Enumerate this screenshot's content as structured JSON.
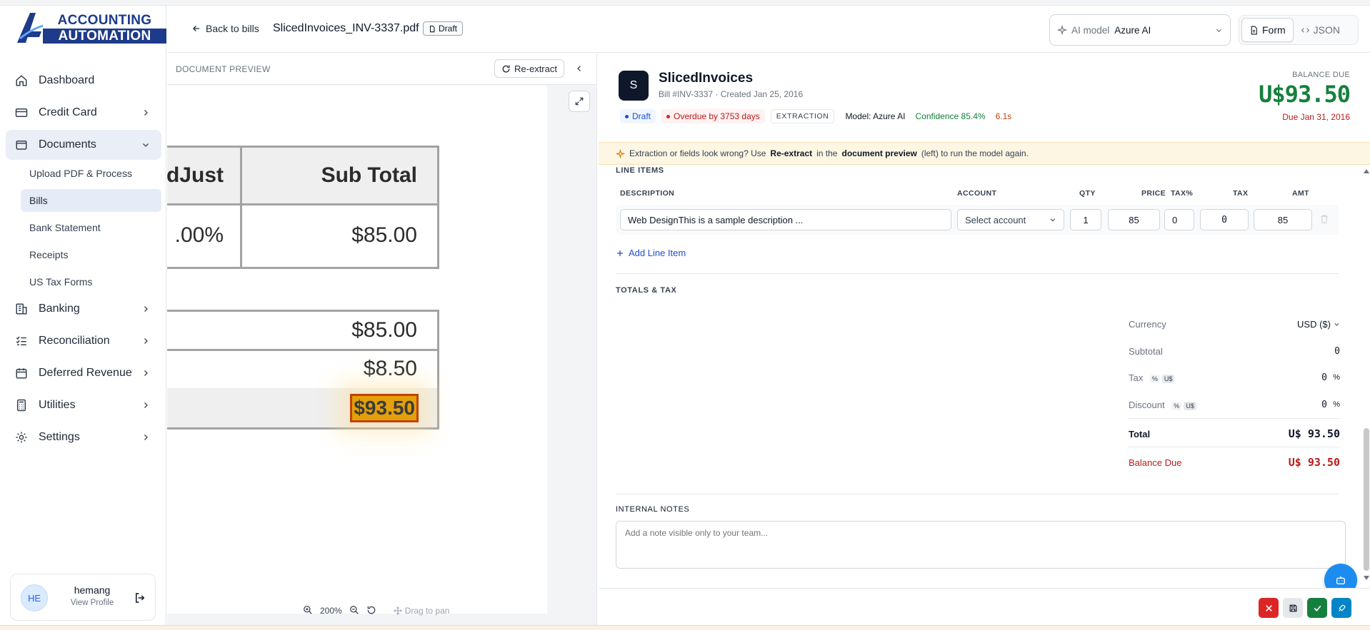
{
  "brand": {
    "line1": "ACCOUNTING",
    "line2": "AUTOMATION"
  },
  "sidebar": {
    "items": [
      {
        "label": "Dashboard",
        "icon": "home-icon"
      },
      {
        "label": "Credit Card",
        "icon": "credit-card-icon"
      },
      {
        "label": "Documents",
        "icon": "document-icon",
        "expanded": true
      },
      {
        "label": "Banking",
        "icon": "bank-icon"
      },
      {
        "label": "Reconciliation",
        "icon": "checklist-icon"
      },
      {
        "label": "Deferred Revenue",
        "icon": "calendar-icon"
      },
      {
        "label": "Utilities",
        "icon": "calculator-icon"
      },
      {
        "label": "Settings",
        "icon": "gear-icon"
      }
    ],
    "documents_sub": [
      {
        "label": "Upload PDF & Process"
      },
      {
        "label": "Bills",
        "active": true
      },
      {
        "label": "Bank Statement"
      },
      {
        "label": "Receipts"
      },
      {
        "label": "US Tax Forms"
      }
    ],
    "profile": {
      "initials": "HE",
      "name": "hemang",
      "link": "View Profile"
    }
  },
  "topbar": {
    "back_label": "Back to bills",
    "file_name": "SlicedInvoices_INV-3337.pdf",
    "status": "Draft",
    "ai_model_label": "AI model",
    "ai_model_value": "Azure AI",
    "view_form": "Form",
    "view_json": "JSON"
  },
  "preview": {
    "title": "DOCUMENT PREVIEW",
    "reextract": "Re-extract",
    "zoom": "200%",
    "drag_hint": "Drag to pan",
    "doc": {
      "adjust_header": "dJust",
      "subtotal_header": "Sub Total",
      "adjust_value": ".00%",
      "row_subtotal": "$85.00",
      "sum_subtotal": "$85.00",
      "sum_tax": "$8.50",
      "sum_total": "$93.50"
    }
  },
  "bill": {
    "avatar_letter": "S",
    "vendor": "SlicedInvoices",
    "meta": "Bill #INV-3337 · Created Jan 25, 2016",
    "chips": {
      "status": "Draft",
      "overdue": "Overdue by 3753 days",
      "extraction": "EXTRACTION",
      "model": "Model: Azure AI",
      "confidence": "Confidence 85.4%",
      "time": "6.1s"
    },
    "balance_label": "BALANCE DUE",
    "balance_value": "U$93.50",
    "due": "Due Jan 31, 2016"
  },
  "notice": {
    "p1": "Extraction or fields look wrong? Use",
    "b1": "Re-extract",
    "p2": "in the",
    "b2": "document preview",
    "p3": "(left) to run the model again."
  },
  "line_items": {
    "section": "LINE ITEMS",
    "columns": {
      "description": "DESCRIPTION",
      "account": "ACCOUNT",
      "qty": "QTY",
      "price": "PRICE",
      "taxpct": "TAX%",
      "tax": "TAX",
      "amt": "AMT"
    },
    "rows": [
      {
        "description": "Web DesignThis is a sample description ...",
        "account": "Select account",
        "qty": "1",
        "price": "85",
        "taxpct": "0",
        "tax": "0",
        "amt": "85"
      }
    ],
    "add_label": "Add Line Item"
  },
  "totals": {
    "section": "TOTALS & TAX",
    "currency_label": "Currency",
    "currency_value": "USD ($)",
    "subtotal_label": "Subtotal",
    "subtotal_value": "0",
    "tax_label": "Tax",
    "tax_value": "0",
    "discount_label": "Discount",
    "discount_value": "0",
    "pct": "%",
    "us": "U$",
    "total_label": "Total",
    "total_value": "U$ 93.50",
    "balance_label": "Balance Due",
    "balance_value": "U$ 93.50"
  },
  "notes": {
    "section": "INTERNAL NOTES",
    "placeholder": "Add a note visible only to your team..."
  },
  "colors": {
    "brand": "#1e3a8a",
    "accent": "#1d8cf0",
    "success": "#15803d",
    "danger": "#b91c1c",
    "highlight": "#e3a008"
  }
}
